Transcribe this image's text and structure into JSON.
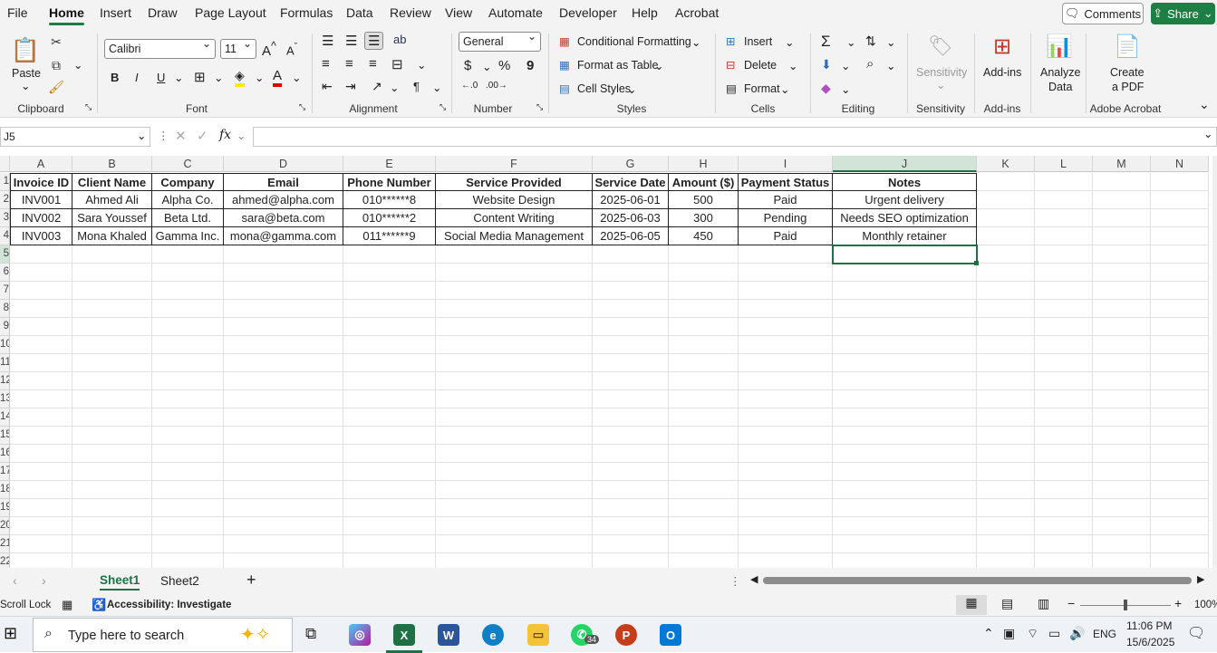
{
  "menu": {
    "tabs": [
      "File",
      "Home",
      "Insert",
      "Draw",
      "Page Layout",
      "Formulas",
      "Data",
      "Review",
      "View",
      "Automate",
      "Developer",
      "Help",
      "Acrobat"
    ],
    "comments": "Comments",
    "share": "Share"
  },
  "ribbon": {
    "clipboard": {
      "paste": "Paste",
      "label": "Clipboard"
    },
    "font": {
      "name": "Calibri",
      "size": "11",
      "bold": "B",
      "italic": "I",
      "underline": "U",
      "label": "Font"
    },
    "alignment": {
      "label": "Alignment"
    },
    "number": {
      "format": "General",
      "currency": "$",
      "percent": "%",
      "comma": "9",
      "label": "Number"
    },
    "styles": {
      "conditional": "Conditional Formatting",
      "table": "Format as Table",
      "cell": "Cell Styles",
      "label": "Styles"
    },
    "cells": {
      "insert": "Insert",
      "delete": "Delete",
      "format": "Format",
      "label": "Cells"
    },
    "editing": {
      "label": "Editing"
    },
    "sensitivity": {
      "button": "Sensitivity",
      "label": "Sensitivity"
    },
    "addins": {
      "button": "Add-ins",
      "label": "Add-ins"
    },
    "analyze": {
      "line1": "Analyze",
      "line2": "Data"
    },
    "acrobat": {
      "line1": "Create",
      "line2": "a PDF",
      "label": "Adobe Acrobat"
    }
  },
  "formula": {
    "namebox": "J5",
    "fx": "fx",
    "value": ""
  },
  "columns": [
    "A",
    "B",
    "C",
    "D",
    "E",
    "F",
    "G",
    "H",
    "I",
    "J",
    "K",
    "L",
    "M",
    "N"
  ],
  "rows": [
    "1",
    "2",
    "3",
    "4",
    "5",
    "6",
    "7",
    "8",
    "9",
    "10",
    "11",
    "12",
    "13",
    "14",
    "15",
    "16",
    "17",
    "18",
    "19",
    "20",
    "21",
    "22"
  ],
  "table": {
    "headers": [
      "Invoice ID",
      "Client Name",
      "Company",
      "Email",
      "Phone Number",
      "Service Provided",
      "Service Date",
      "Amount ($)",
      "Payment Status",
      "Notes"
    ],
    "rows": [
      [
        "INV001",
        "Ahmed Ali",
        "Alpha Co.",
        "ahmed@alpha.com",
        "010******8",
        "Website Design",
        "2025-06-01",
        "500",
        "Paid",
        "Urgent delivery"
      ],
      [
        "INV002",
        "Sara Youssef",
        "Beta Ltd.",
        "sara@beta.com",
        "010******2",
        "Content Writing",
        "2025-06-03",
        "300",
        "Pending",
        "Needs SEO optimization"
      ],
      [
        "INV003",
        "Mona Khaled",
        "Gamma Inc.",
        "mona@gamma.com",
        "011******9",
        "Social Media Management",
        "2025-06-05",
        "450",
        "Paid",
        "Monthly retainer"
      ]
    ]
  },
  "sheets": {
    "tabs": [
      "Sheet1",
      "Sheet2"
    ],
    "active": "Sheet1"
  },
  "status": {
    "scroll": "Scroll Lock",
    "accessibility": "Accessibility: Investigate",
    "zoom": "100%"
  },
  "taskbar": {
    "search": "Type here to search",
    "whatsapp_badge": "34",
    "lang": "ENG",
    "time": "11:06 PM",
    "date": "15/6/2025"
  },
  "colors": {
    "excel_green": "#1e7145",
    "share_green": "#1e7f45"
  }
}
